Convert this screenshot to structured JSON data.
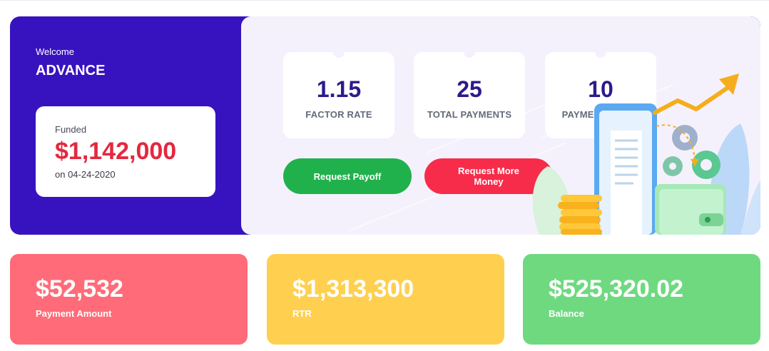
{
  "advance": {
    "welcome": "Welcome",
    "name": "ADVANCE",
    "funded_label": "Funded",
    "funded_amount": "$1,142,000",
    "funded_date": "on 04-24-2020"
  },
  "stats": [
    {
      "value": "1.15",
      "label": "FACTOR RATE"
    },
    {
      "value": "25",
      "label": "TOTAL PAYMENTS"
    },
    {
      "value": "10",
      "label": "PAYMENTS LEFT"
    }
  ],
  "actions": {
    "payoff_label": "Request Payoff",
    "more_label": "Request More Money"
  },
  "metrics": [
    {
      "value": "$52,532",
      "label": "Payment Amount"
    },
    {
      "value": "$1,313,300",
      "label": "RTR"
    },
    {
      "value": "$525,320.02",
      "label": "Balance"
    }
  ],
  "colors": {
    "brand": "#3713c0",
    "funded_amount": "#e3283f",
    "payoff_button": "#21b14c",
    "more_money_button": "#f72c4a",
    "payment_card": "#ff6b78",
    "rtr_card": "#ffd04f",
    "balance_card": "#6fd980"
  },
  "icons": [
    "growth-arrow-icon",
    "gear-icon",
    "wallet-icon",
    "coin-stack-icon",
    "receipt-icon",
    "leaf-icon"
  ]
}
